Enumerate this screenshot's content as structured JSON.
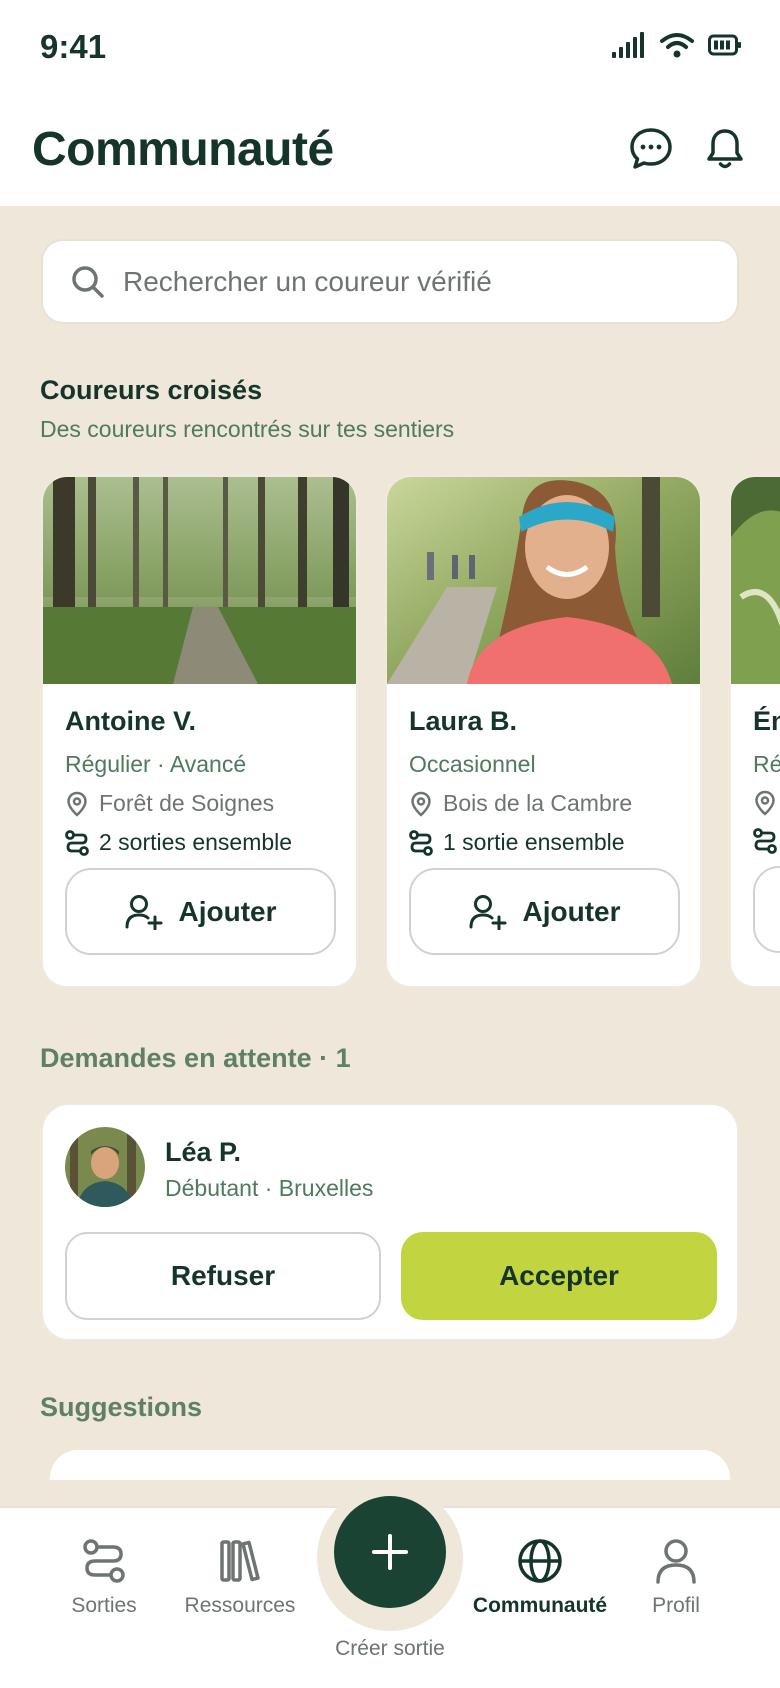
{
  "status": {
    "time": "9:41"
  },
  "header": {
    "title": "Communauté"
  },
  "search": {
    "placeholder": "Rechercher un coureur vérifié"
  },
  "crossed": {
    "title": "Coureurs croisés",
    "subtitle": "Des coureurs rencontrés sur tes sentiers",
    "cards": [
      {
        "name": "Antoine V.",
        "level": "Régulier · Avancé",
        "location": "Forêt de Soignes",
        "runs": "2 sorties ensemble",
        "button": "Ajouter"
      },
      {
        "name": "Laura B.",
        "level": "Occasionnel",
        "location": "Bois de la Cambre",
        "runs": "1 sortie ensemble",
        "button": "Ajouter"
      },
      {
        "name": "Ém",
        "level": "Ré"
      }
    ]
  },
  "pending": {
    "title": "Demandes en attente · 1",
    "request": {
      "name": "Léa P.",
      "meta": "Débutant · Bruxelles",
      "refuse": "Refuser",
      "accept": "Accepter"
    }
  },
  "suggestions": {
    "title": "Suggestions"
  },
  "tabbar": {
    "tabs": [
      {
        "label": "Sorties",
        "icon": "route-icon"
      },
      {
        "label": "Ressources",
        "icon": "library-icon"
      },
      {
        "label": "Communauté",
        "icon": "globe-icon",
        "active": true
      },
      {
        "label": "Profil",
        "icon": "person-icon"
      }
    ],
    "create": "Créer sortie"
  },
  "colors": {
    "primary": "#15352A",
    "accent": "#C2D540",
    "background": "#EEE7DA",
    "muted_green": "#4F7A5B"
  }
}
